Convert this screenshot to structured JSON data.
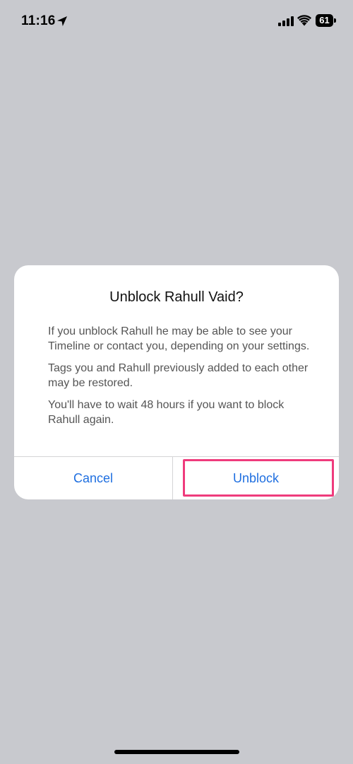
{
  "status_bar": {
    "time": "11:16",
    "battery_level": "61",
    "icons": [
      "location-arrow-icon",
      "cellular-signal-icon",
      "wifi-icon",
      "battery-icon"
    ]
  },
  "dialog": {
    "title": "Unblock Rahull Vaid?",
    "paragraphs": [
      "If you unblock Rahull he may be able to see your Timeline or contact you, depending on your settings.",
      "Tags you and Rahull previously added to each other may be restored.",
      "You'll have to wait 48 hours if you want to block Rahull again."
    ],
    "cancel_label": "Cancel",
    "confirm_label": "Unblock"
  },
  "colors": {
    "background": "#c8c9ce",
    "dialog_background": "#ffffff",
    "button_text": "#1f6fe0",
    "highlight": "#ef3b7c"
  }
}
